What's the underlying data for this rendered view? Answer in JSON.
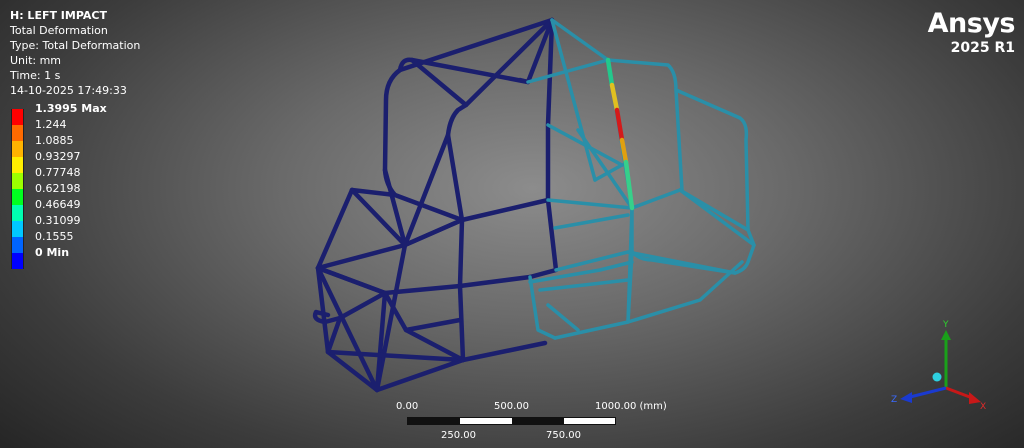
{
  "header": {
    "title": "H: LEFT IMPACT",
    "result_name": "Total Deformation",
    "type_line": "Type: Total Deformation",
    "unit_line": "Unit: mm",
    "time_line": "Time: 1 s",
    "timestamp": "14-10-2025 17:49:33"
  },
  "legend": [
    {
      "label": "1.3995 Max",
      "color": "#ff0000",
      "bold": true
    },
    {
      "label": "1.244",
      "color": "#ff6a00",
      "bold": false
    },
    {
      "label": "1.0885",
      "color": "#ffb300",
      "bold": false
    },
    {
      "label": "0.93297",
      "color": "#ffee00",
      "bold": false
    },
    {
      "label": "0.77748",
      "color": "#9cff00",
      "bold": false
    },
    {
      "label": "0.62198",
      "color": "#00ff20",
      "bold": false
    },
    {
      "label": "0.46649",
      "color": "#00ffb0",
      "bold": false
    },
    {
      "label": "0.31099",
      "color": "#00c8ff",
      "bold": false
    },
    {
      "label": "0.1555",
      "color": "#0064ff",
      "bold": false
    },
    {
      "label": "0 Min",
      "color": "#0000ff",
      "bold": true
    }
  ],
  "branding": {
    "product": "Ansys",
    "version": "2025 R1"
  },
  "scale_bar": {
    "top_labels": [
      "0.00",
      "500.00",
      "1000.00 (mm)"
    ],
    "bottom_labels": [
      "250.00",
      "750.00"
    ]
  },
  "triad": {
    "x_label": "X",
    "y_label": "Y",
    "z_label": "Z"
  },
  "colors": {
    "frame_low": "#1b1f6e",
    "frame_mid": "#2a8fa8",
    "frame_high": "#d41a1a"
  }
}
